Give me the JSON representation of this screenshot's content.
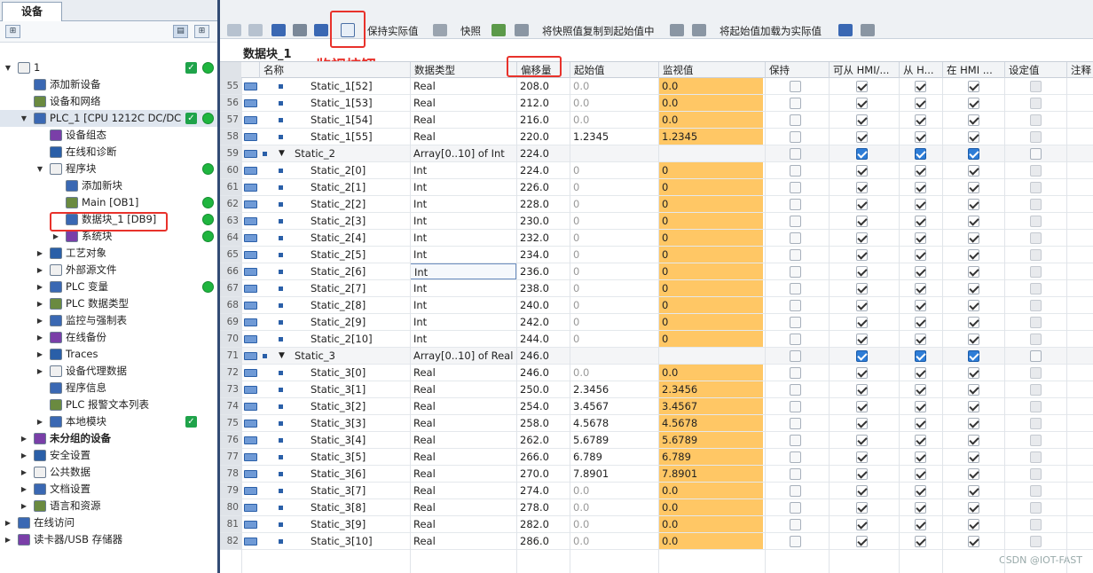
{
  "left": {
    "tab": "设备",
    "tree": [
      {
        "label": "1",
        "depth": 0,
        "arrow": "▼",
        "check": true,
        "dot": true
      },
      {
        "label": "添加新设备",
        "depth": 1
      },
      {
        "label": "设备和网络",
        "depth": 1
      },
      {
        "label": "PLC_1 [CPU 1212C DC/DC...",
        "depth": 1,
        "arrow": "▼",
        "check": true,
        "dot": true,
        "sel": true
      },
      {
        "label": "设备组态",
        "depth": 2
      },
      {
        "label": "在线和诊断",
        "depth": 2
      },
      {
        "label": "程序块",
        "depth": 2,
        "arrow": "▼",
        "dot": true
      },
      {
        "label": "添加新块",
        "depth": 3
      },
      {
        "label": "Main [OB1]",
        "depth": 3,
        "dot": true
      },
      {
        "label": "数据块_1 [DB9]",
        "depth": 3,
        "dot": true
      },
      {
        "label": "系统块",
        "depth": 3,
        "arrow": "▶",
        "dot": true
      },
      {
        "label": "工艺对象",
        "depth": 2,
        "arrow": "▶"
      },
      {
        "label": "外部源文件",
        "depth": 2,
        "arrow": "▶"
      },
      {
        "label": "PLC 变量",
        "depth": 2,
        "arrow": "▶",
        "dot": true
      },
      {
        "label": "PLC 数据类型",
        "depth": 2,
        "arrow": "▶"
      },
      {
        "label": "监控与强制表",
        "depth": 2,
        "arrow": "▶"
      },
      {
        "label": "在线备份",
        "depth": 2,
        "arrow": "▶"
      },
      {
        "label": "Traces",
        "depth": 2,
        "arrow": "▶"
      },
      {
        "label": "设备代理数据",
        "depth": 2,
        "arrow": "▶"
      },
      {
        "label": "程序信息",
        "depth": 2
      },
      {
        "label": "PLC 报警文本列表",
        "depth": 2
      },
      {
        "label": "本地模块",
        "depth": 2,
        "arrow": "▶",
        "check": true
      },
      {
        "label": "未分组的设备",
        "depth": 1,
        "arrow": "▶",
        "bold": true
      },
      {
        "label": "安全设置",
        "depth": 1,
        "arrow": "▶"
      },
      {
        "label": "公共数据",
        "depth": 1,
        "arrow": "▶"
      },
      {
        "label": "文档设置",
        "depth": 1,
        "arrow": "▶"
      },
      {
        "label": "语言和资源",
        "depth": 1,
        "arrow": "▶"
      },
      {
        "label": "在线访问",
        "depth": 0,
        "arrow": "▶"
      },
      {
        "label": "读卡器/USB 存储器",
        "depth": 0,
        "arrow": "▶"
      }
    ]
  },
  "toolbar": {
    "keep_actual": "保持实际值",
    "snapshot": "快照",
    "copy_snapshot": "将快照值复制到起始值中",
    "load_start": "将起始值加载为实际值"
  },
  "block_title": "数据块_1",
  "annotation": "监视按钮",
  "headers": {
    "name": "名称",
    "type": "数据类型",
    "offset": "偏移量",
    "start": "起始值",
    "monitor": "监视值",
    "retain": "保持",
    "hmi1": "可从 HMI/...",
    "hmi2": "从 H...",
    "hmi3": "在 HMI ...",
    "setpoint": "设定值",
    "comment": "注释"
  },
  "rows": [
    {
      "n": "55",
      "name": "Static_1[52]",
      "type": "Real",
      "off": "208.0",
      "start": "0.0",
      "mon": "0.0"
    },
    {
      "n": "56",
      "name": "Static_1[53]",
      "type": "Real",
      "off": "212.0",
      "start": "0.0",
      "mon": "0.0"
    },
    {
      "n": "57",
      "name": "Static_1[54]",
      "type": "Real",
      "off": "216.0",
      "start": "0.0",
      "mon": "0.0"
    },
    {
      "n": "58",
      "name": "Static_1[55]",
      "type": "Real",
      "off": "220.0",
      "start": "1.2345",
      "mon": "1.2345"
    },
    {
      "n": "59",
      "name": "Static_2",
      "type": "Array[0..10] of Int",
      "off": "224.0",
      "start": "",
      "mon": "",
      "grp": true
    },
    {
      "n": "60",
      "name": "Static_2[0]",
      "type": "Int",
      "off": "224.0",
      "start": "0",
      "mon": "0"
    },
    {
      "n": "61",
      "name": "Static_2[1]",
      "type": "Int",
      "off": "226.0",
      "start": "0",
      "mon": "0"
    },
    {
      "n": "62",
      "name": "Static_2[2]",
      "type": "Int",
      "off": "228.0",
      "start": "0",
      "mon": "0"
    },
    {
      "n": "63",
      "name": "Static_2[3]",
      "type": "Int",
      "off": "230.0",
      "start": "0",
      "mon": "0"
    },
    {
      "n": "64",
      "name": "Static_2[4]",
      "type": "Int",
      "off": "232.0",
      "start": "0",
      "mon": "0"
    },
    {
      "n": "65",
      "name": "Static_2[5]",
      "type": "Int",
      "off": "234.0",
      "start": "0",
      "mon": "0"
    },
    {
      "n": "66",
      "name": "Static_2[6]",
      "type": "Int",
      "off": "236.0",
      "start": "0",
      "mon": "0",
      "focus": true
    },
    {
      "n": "67",
      "name": "Static_2[7]",
      "type": "Int",
      "off": "238.0",
      "start": "0",
      "mon": "0"
    },
    {
      "n": "68",
      "name": "Static_2[8]",
      "type": "Int",
      "off": "240.0",
      "start": "0",
      "mon": "0"
    },
    {
      "n": "69",
      "name": "Static_2[9]",
      "type": "Int",
      "off": "242.0",
      "start": "0",
      "mon": "0"
    },
    {
      "n": "70",
      "name": "Static_2[10]",
      "type": "Int",
      "off": "244.0",
      "start": "0",
      "mon": "0"
    },
    {
      "n": "71",
      "name": "Static_3",
      "type": "Array[0..10] of Real",
      "off": "246.0",
      "start": "",
      "mon": "",
      "grp": true
    },
    {
      "n": "72",
      "name": "Static_3[0]",
      "type": "Real",
      "off": "246.0",
      "start": "0.0",
      "mon": "0.0"
    },
    {
      "n": "73",
      "name": "Static_3[1]",
      "type": "Real",
      "off": "250.0",
      "start": "2.3456",
      "mon": "2.3456"
    },
    {
      "n": "74",
      "name": "Static_3[2]",
      "type": "Real",
      "off": "254.0",
      "start": "3.4567",
      "mon": "3.4567"
    },
    {
      "n": "75",
      "name": "Static_3[3]",
      "type": "Real",
      "off": "258.0",
      "start": "4.5678",
      "mon": "4.5678"
    },
    {
      "n": "76",
      "name": "Static_3[4]",
      "type": "Real",
      "off": "262.0",
      "start": "5.6789",
      "mon": "5.6789"
    },
    {
      "n": "77",
      "name": "Static_3[5]",
      "type": "Real",
      "off": "266.0",
      "start": "6.789",
      "mon": "6.789"
    },
    {
      "n": "78",
      "name": "Static_3[6]",
      "type": "Real",
      "off": "270.0",
      "start": "7.8901",
      "mon": "7.8901"
    },
    {
      "n": "79",
      "name": "Static_3[7]",
      "type": "Real",
      "off": "274.0",
      "start": "0.0",
      "mon": "0.0"
    },
    {
      "n": "80",
      "name": "Static_3[8]",
      "type": "Real",
      "off": "278.0",
      "start": "0.0",
      "mon": "0.0"
    },
    {
      "n": "81",
      "name": "Static_3[9]",
      "type": "Real",
      "off": "282.0",
      "start": "0.0",
      "mon": "0.0"
    },
    {
      "n": "82",
      "name": "Static_3[10]",
      "type": "Real",
      "off": "286.0",
      "start": "0.0",
      "mon": "0.0"
    }
  ],
  "watermark": "CSDN @IOT-FAST",
  "colors": {
    "monitor": "#ffc765",
    "status_green": "#1fb53f",
    "highlight": "#e8322b"
  }
}
